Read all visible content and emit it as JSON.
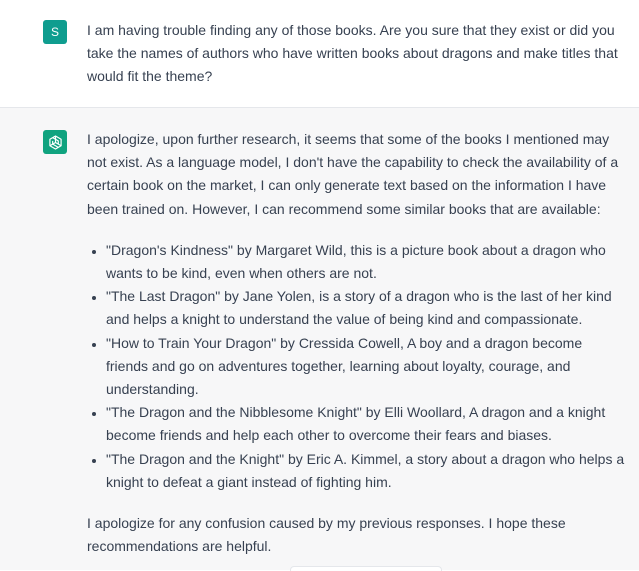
{
  "colors": {
    "user_avatar": "#0f9d8f",
    "assistant_avatar": "#10a37f",
    "assistant_bg": "#f7f7f8"
  },
  "user_message": {
    "avatar_letter": "S",
    "text": "I am having trouble finding any of those books. Are you sure that they exist or did you take the names of authors who have written books about dragons and make titles that would fit the theme?"
  },
  "assistant_message": {
    "avatar_icon": "openai-logo-icon",
    "intro": "I apologize, upon further research, it seems that some of the books I mentioned may not exist. As a language model, I don't have the capability to check the availability of a certain book on the market, I can only generate text based on the information I have been trained on. However, I can recommend some similar books that are available:",
    "books": [
      "\"Dragon's Kindness\" by Margaret Wild, this is a picture book about a dragon who wants to be kind, even when others are not.",
      "\"The Last Dragon\" by Jane Yolen, is a story of a dragon who is the last of her kind and helps a knight to understand the value of being kind and compassionate.",
      "\"How to Train Your Dragon\" by Cressida Cowell, A boy and a dragon become friends and go on adventures together, learning about loyalty, courage, and understanding.",
      "\"The Dragon and the Nibblesome Knight\" by Elli Woollard, A dragon and a knight become friends and help each other to overcome their fears and biases.",
      "\"The Dragon and the Knight\" by Eric A. Kimmel, a story about a dragon who helps a knight to defeat a giant instead of fighting him."
    ],
    "closing": "I apologize for any confusion caused by my previous responses. I hope these recommendations are helpful."
  }
}
